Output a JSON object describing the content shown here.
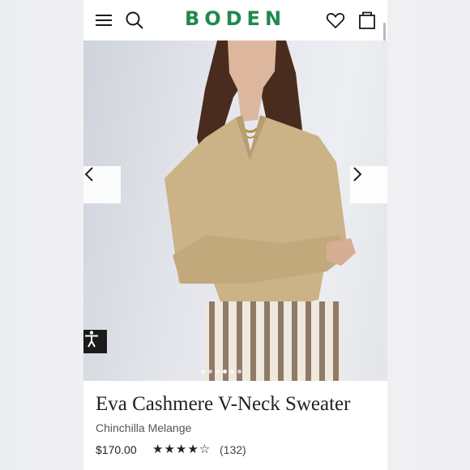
{
  "header": {
    "logo": "BODEN",
    "menu_icon": "hamburger-menu-icon",
    "search_icon": "search-icon",
    "wishlist_icon": "heart-icon",
    "bag_icon": "shopping-bag-icon",
    "brand_color": "#1f8a4c"
  },
  "gallery": {
    "prev_icon": "chevron-left-icon",
    "next_icon": "chevron-right-icon",
    "accessibility_icon": "accessibility-icon",
    "image_count": 6,
    "active_index": 4
  },
  "product": {
    "title": "Eva Cashmere V-Neck Sweater",
    "color_name": "Chinchilla Melange",
    "price": "$170.00",
    "rating_stars": "★★★★☆",
    "rating_value": 4,
    "rating_max": 5,
    "review_count": "(132)"
  }
}
